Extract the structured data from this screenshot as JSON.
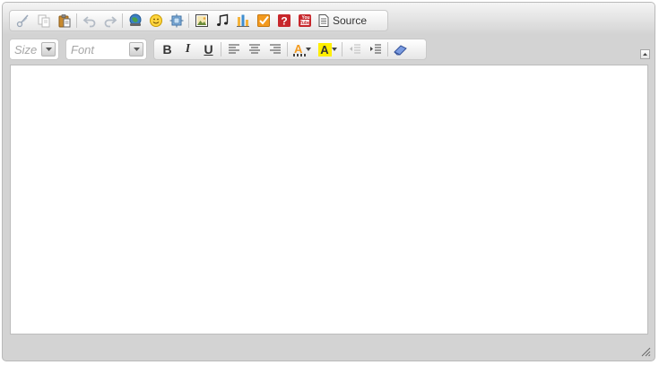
{
  "toolbar_row1": {
    "buttons": [
      {
        "name": "cut",
        "icon": "scissors-icon"
      },
      {
        "name": "copy",
        "icon": "copy-icon"
      },
      {
        "name": "paste",
        "icon": "paste-icon"
      },
      {
        "name": "undo",
        "icon": "undo-icon"
      },
      {
        "name": "redo",
        "icon": "redo-icon"
      },
      {
        "name": "link",
        "icon": "link-icon"
      },
      {
        "name": "smiley",
        "icon": "smiley-icon"
      },
      {
        "name": "iframe",
        "icon": "iframe-icon"
      },
      {
        "name": "image",
        "icon": "image-icon"
      },
      {
        "name": "audio",
        "icon": "music-note-icon"
      },
      {
        "name": "chart",
        "icon": "chart-icon"
      },
      {
        "name": "checkbox",
        "icon": "checkbox-icon"
      },
      {
        "name": "help",
        "icon": "question-icon"
      },
      {
        "name": "youtube",
        "icon": "youtube-icon"
      }
    ],
    "source_label": "Source"
  },
  "toolbar_row2": {
    "size_placeholder": "Size",
    "font_placeholder": "Font",
    "bold_label": "B",
    "italic_label": "I",
    "underline_label": "U",
    "text_color_label": "A",
    "bg_color_label": "A"
  },
  "colors": {
    "accent_orange": "#f39a1e",
    "highlight_yellow": "#ffee00",
    "frame_gray": "#d3d3d3"
  },
  "content": {
    "text": ""
  }
}
